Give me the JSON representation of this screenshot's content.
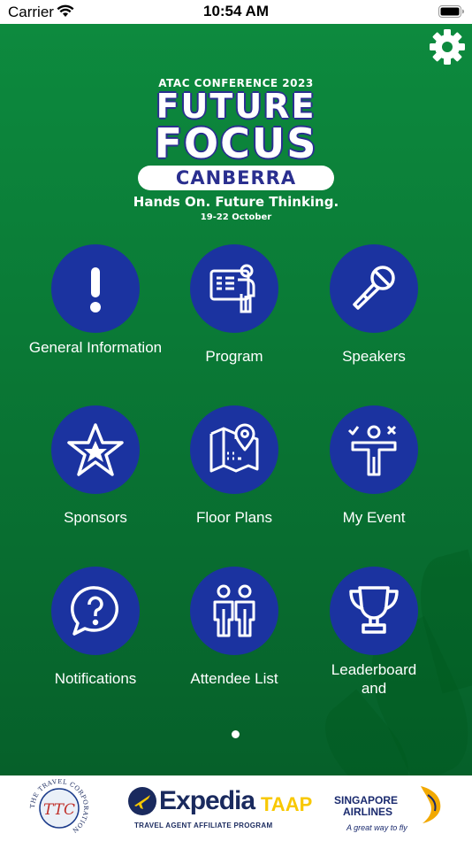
{
  "status": {
    "carrier": "Carrier",
    "time": "10:54 AM"
  },
  "logo": {
    "sub": "ATAC CONFERENCE 2023",
    "line1": "FUTURE",
    "line2": "FOCUS",
    "city": "CANBERRA",
    "tagline": "Hands On. Future Thinking.",
    "dates": "19-22 October"
  },
  "menu": [
    {
      "label": "General Information",
      "icon": "exclamation-icon"
    },
    {
      "label": "Program",
      "icon": "presentation-icon"
    },
    {
      "label": "Speakers",
      "icon": "microphone-icon"
    },
    {
      "label": "Sponsors",
      "icon": "star-icon"
    },
    {
      "label": "Floor Plans",
      "icon": "map-pin-icon"
    },
    {
      "label": "My Event",
      "icon": "strategy-person-icon"
    },
    {
      "label": "Notifications",
      "icon": "question-bubble-icon"
    },
    {
      "label": "Attendee List",
      "icon": "people-icon"
    },
    {
      "label": "Leaderboard and",
      "icon": "trophy-icon"
    }
  ],
  "sponsors": {
    "ttc": "THE TRAVEL CORPORATION",
    "ttc_mark": "TTC",
    "expedia": "Expedia",
    "taap": "TAAP",
    "expedia_sub": "TRAVEL AGENT   AFFILIATE PROGRAM",
    "sia_name_1": "SINGAPORE",
    "sia_name_2": "AIRLINES",
    "sia_tag": "A great way to fly"
  },
  "colors": {
    "green": "#0a7a36",
    "circle": "#1b33a0",
    "navy": "#2a2f8f"
  }
}
